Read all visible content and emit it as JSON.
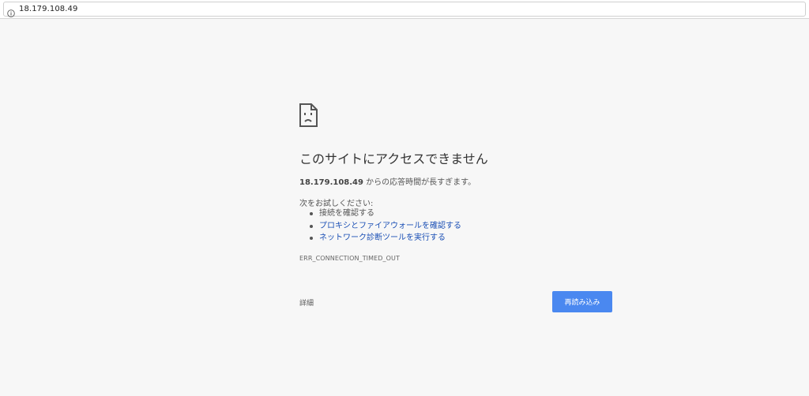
{
  "browser": {
    "url": "18.179.108.49",
    "info_icon": "info-icon"
  },
  "error_page": {
    "icon": "sad-page-icon",
    "title": "このサイトにアクセスできません",
    "summary_host": "18.179.108.49",
    "summary_text": " からの応答時間が長すぎます。",
    "try_label": "次をお試しください:",
    "suggestions": [
      {
        "label": "接続を確認する",
        "is_link": false
      },
      {
        "label": "プロキシとファイアウォールを確認する",
        "is_link": true
      },
      {
        "label": "ネットワーク診断ツールを実行する",
        "is_link": true
      }
    ],
    "error_code": "ERR_CONNECTION_TIMED_OUT",
    "details_label": "詳細",
    "reload_label": "再読み込み",
    "colors": {
      "background": "#f7f7f7",
      "link": "#1a4fb5",
      "button": "#4a88f0"
    }
  }
}
